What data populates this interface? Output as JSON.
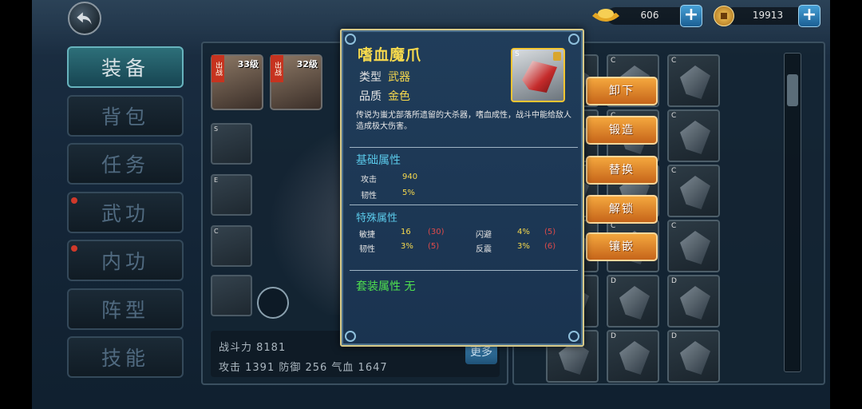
{
  "currency": {
    "ingot": {
      "value": "606"
    },
    "coin": {
      "value": "19913"
    },
    "plus_label": "+"
  },
  "side_menu": [
    {
      "label": "装备",
      "active": true,
      "dot": false
    },
    {
      "label": "背包",
      "active": false,
      "dot": false
    },
    {
      "label": "任务",
      "active": false,
      "dot": false
    },
    {
      "label": "武功",
      "active": false,
      "dot": true
    },
    {
      "label": "内功",
      "active": false,
      "dot": true
    },
    {
      "label": "阵型",
      "active": false,
      "dot": false
    },
    {
      "label": "技能",
      "active": false,
      "dot": false
    }
  ],
  "portraits": [
    {
      "tag": "出战",
      "level": "33级"
    },
    {
      "tag": "出战",
      "level": "32级"
    }
  ],
  "equip_slots": [
    "S",
    "E",
    "C",
    ""
  ],
  "char_stats": {
    "line1": "战斗力 8181",
    "line2": "攻击 1391  防御 256  气血 1647",
    "more": "更多"
  },
  "actions": [
    "卸下",
    "锻造",
    "替换",
    "解锁",
    "镶嵌"
  ],
  "inventory_grades": [
    "C",
    "C",
    "C",
    "C",
    "C",
    "C",
    "C",
    "C",
    "C",
    "C",
    "C",
    "C",
    "D",
    "D",
    "D",
    "D",
    "D",
    "D"
  ],
  "popup": {
    "title": "嗜血魔爪",
    "type_label": "类型",
    "type_value": "武器",
    "quality_label": "品质",
    "quality_value": "金色",
    "grade": "S",
    "description": "传说为蚩尤部落所遗留的大杀器，嗜血成性，战斗中能给敌人造成极大伤害。",
    "base_title": "基础属性",
    "base": [
      {
        "name": "攻击",
        "value": "940"
      },
      {
        "name": "韧性",
        "value": "5%"
      }
    ],
    "special_title": "特殊属性",
    "special": [
      {
        "name": "敏捷",
        "value": "16",
        "extra": "(30)",
        "name2": "闪避",
        "value2": "4%",
        "extra2": "(5)"
      },
      {
        "name": "韧性",
        "value": "3%",
        "extra": "(5)",
        "name2": "反震",
        "value2": "3%",
        "extra2": "(6)"
      }
    ],
    "set_text": "套装属性 无"
  },
  "colors": {
    "accent_gold": "#f7d94d",
    "section_blue": "#5ac8e8",
    "set_green": "#4fe04f",
    "extra_red": "#e14a4a",
    "action_orange": "#f4a73e"
  }
}
